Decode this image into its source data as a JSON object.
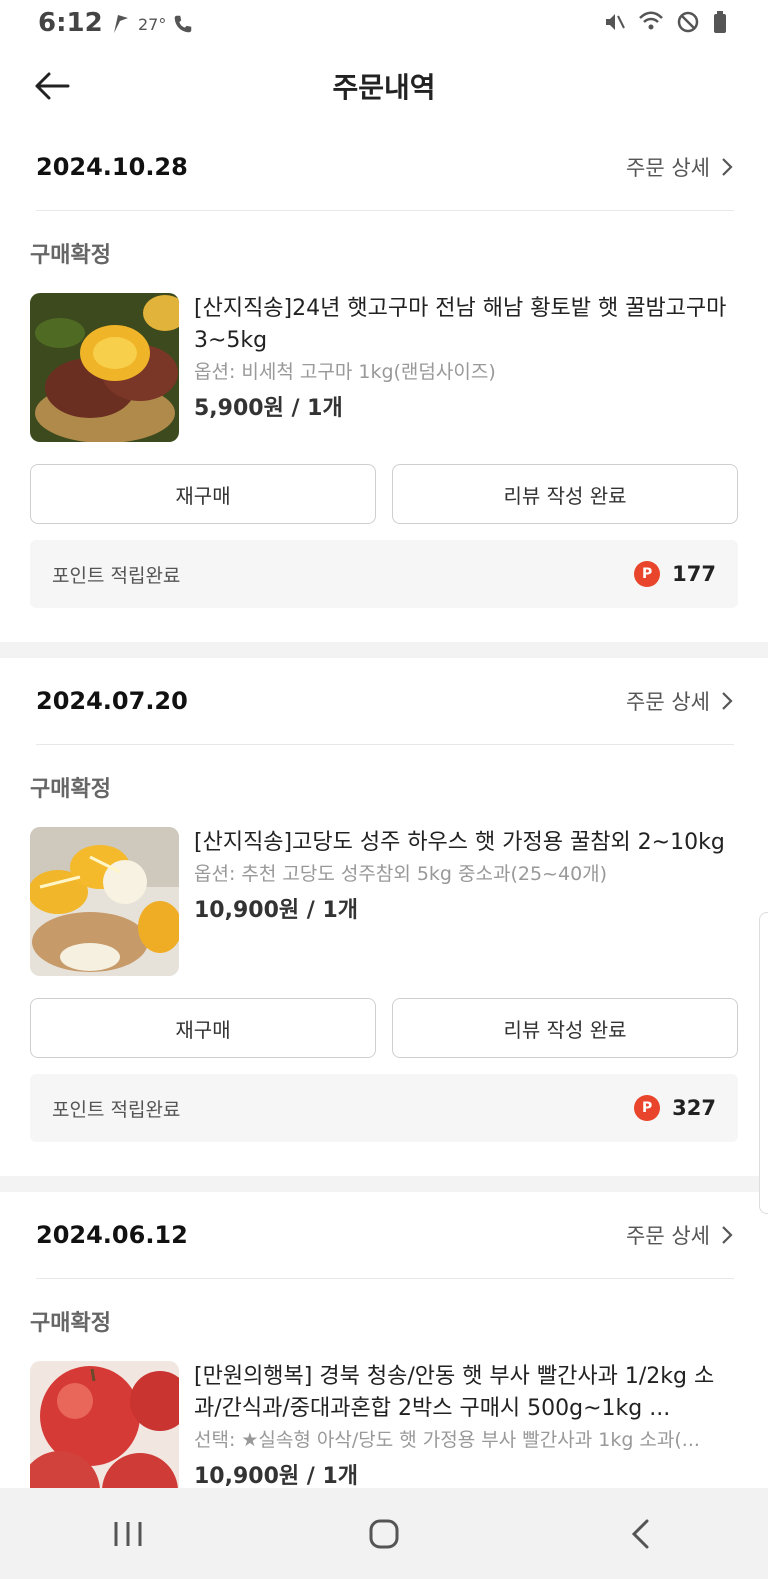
{
  "status_bar": {
    "time": "6:12",
    "temperature": "27°",
    "icons": [
      "flag-icon",
      "call-icon",
      "mute-icon",
      "wifi-icon",
      "do-not-disturb-icon",
      "battery-icon"
    ]
  },
  "header": {
    "title": "주문내역",
    "back_icon": "arrow-left-icon"
  },
  "orders": [
    {
      "date": "2024.10.28",
      "detail_label": "주문 상세",
      "status": "구매확정",
      "item_name": "[산지직송]24년 햇고구마 전남 해남 황토밭 햇 꿀밤고구마 3~5kg",
      "option": "옵션: 비세척 고구마 1kg(랜덤사이즈)",
      "price": "5,900원 / 1개",
      "rebuy_label": "재구매",
      "review_label": "리뷰 작성 완료",
      "points_label": "포인트 적립완료",
      "points_badge": "P",
      "points_value": "177"
    },
    {
      "date": "2024.07.20",
      "detail_label": "주문 상세",
      "status": "구매확정",
      "item_name": "[산지직송]고당도 성주 하우스 햇 가정용 꿀참외 2~10kg",
      "option": "옵션: 추천 고당도 성주참외 5kg 중소과(25~40개)",
      "price": "10,900원 / 1개",
      "rebuy_label": "재구매",
      "review_label": "리뷰 작성 완료",
      "points_label": "포인트 적립완료",
      "points_badge": "P",
      "points_value": "327"
    },
    {
      "date": "2024.06.12",
      "detail_label": "주문 상세",
      "status": "구매확정",
      "item_name": "[만원의행복] 경북 청송/안동 햇 부사 빨간사과 1/2kg 소과/간식과/중대과혼합 2박스 구매시 500g~1kg ...",
      "option": "선택: ★실속형 아삭/당도 햇 가정용 부사 빨간사과 1kg 소과(...",
      "price": "10,900원 / 1개"
    }
  ],
  "colors": {
    "accent_point": "#e8452c",
    "divider": "#f3f3f3",
    "status_text": "#666666"
  },
  "nav": {
    "icons": [
      "recent-apps-icon",
      "home-icon",
      "back-icon"
    ]
  }
}
